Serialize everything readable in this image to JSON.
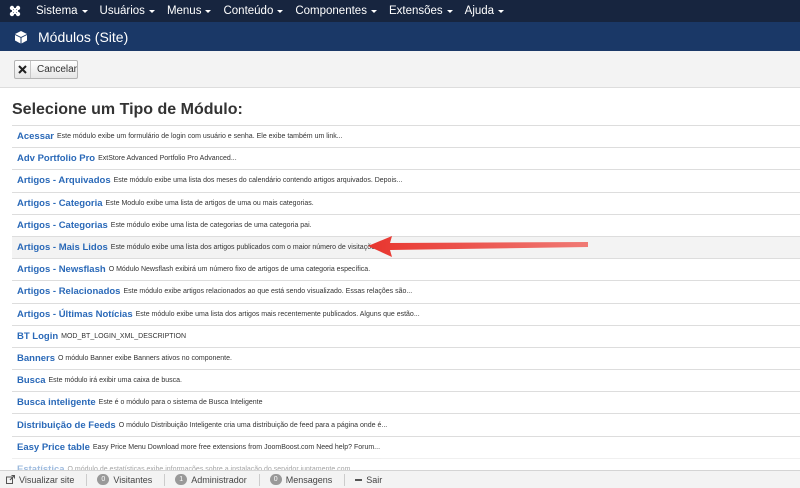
{
  "menubar": {
    "items": [
      {
        "label": "Sistema"
      },
      {
        "label": "Usuários"
      },
      {
        "label": "Menus"
      },
      {
        "label": "Conteúdo"
      },
      {
        "label": "Componentes"
      },
      {
        "label": "Extensões"
      },
      {
        "label": "Ajuda"
      }
    ]
  },
  "header": {
    "title": "Módulos (Site)"
  },
  "toolbar": {
    "cancel_label": "Cancelar"
  },
  "main": {
    "heading": "Selecione um Tipo de Módulo:",
    "modules": [
      {
        "name": "Acessar",
        "desc": "Este módulo exibe um formulário de login com usuário e senha. Ele exibe também um link..."
      },
      {
        "name": "Adv Portfolio Pro",
        "desc": "ExtStore Advanced Portfolio Pro Advanced..."
      },
      {
        "name": "Artigos - Arquivados",
        "desc": "Este módulo exibe uma lista dos meses do calendário contendo artigos arquivados. Depois..."
      },
      {
        "name": "Artigos - Categoria",
        "desc": "Este Modulo exibe uma lista de artigos de uma ou mais categorias."
      },
      {
        "name": "Artigos - Categorias",
        "desc": "Este módulo exibe uma lista de categorias de uma categoria pai."
      },
      {
        "name": "Artigos - Mais Lidos",
        "desc": "Este módulo exibe uma lista dos artigos publicados com o maior número de visitações"
      },
      {
        "name": "Artigos - Newsflash",
        "desc": "O Módulo Newsflash exibirá um número fixo de artigos de uma categoria específica."
      },
      {
        "name": "Artigos - Relacionados",
        "desc": "Este módulo exibe artigos relacionados ao que está sendo visualizado. Essas relações são..."
      },
      {
        "name": "Artigos - Últimas Notícias",
        "desc": "Este módulo exibe uma lista dos artigos mais recentemente publicados. Alguns que estão..."
      },
      {
        "name": "BT Login",
        "desc": "MOD_BT_LOGIN_XML_DESCRIPTION"
      },
      {
        "name": "Banners",
        "desc": "O módulo Banner exibe Banners ativos no componente."
      },
      {
        "name": "Busca",
        "desc": "Este módulo irá exibir uma caixa de busca."
      },
      {
        "name": "Busca inteligente",
        "desc": "Este é o módulo para o sistema de Busca Inteligente"
      },
      {
        "name": "Distribuição de Feeds",
        "desc": "O módulo Distribuição Inteligente cria uma distribuição de feed para a página onde é..."
      },
      {
        "name": "Easy Price table",
        "desc": "Easy Price Menu Download more free extensions from JoomBoost.com Need help? Forum..."
      },
      {
        "name": "Estatística",
        "desc": "O módulo de estatísticas exibe informações sobre a instalação do servidor juntamente com..."
      }
    ]
  },
  "statusbar": {
    "view_site": "Visualizar site",
    "visitors_count": "0",
    "visitors_label": "Visitantes",
    "admin_count": "1",
    "admin_label": "Administrador",
    "messages_count": "0",
    "messages_label": "Mensagens",
    "logout_label": "Sair"
  },
  "colors": {
    "menubar_bg": "#17253f",
    "header_bg": "#1a3867",
    "link": "#2a69b8",
    "annotation_arrow": "#e8352e"
  }
}
